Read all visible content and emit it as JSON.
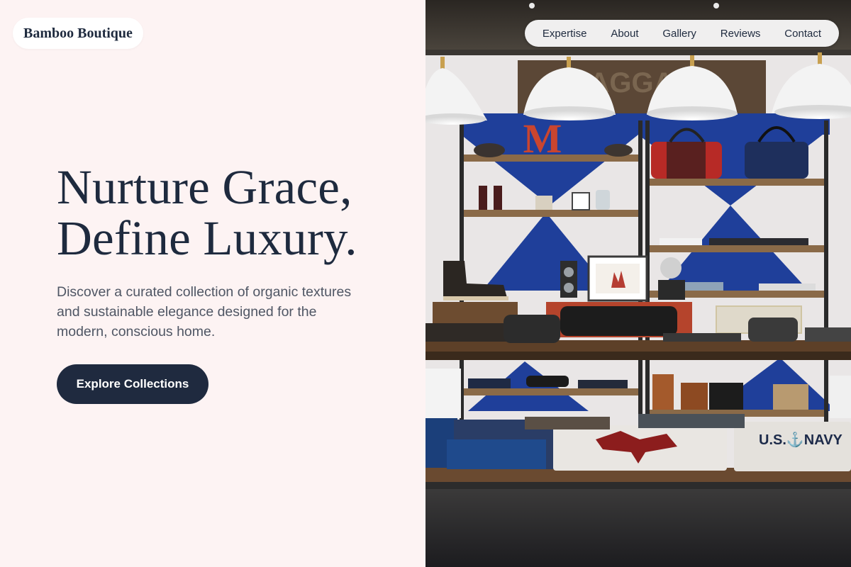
{
  "brand": {
    "name": "Bamboo Boutique"
  },
  "nav": {
    "items": [
      "Expertise",
      "About",
      "Gallery",
      "Reviews",
      "Contact"
    ]
  },
  "hero": {
    "title_line1": "Nurture Grace,",
    "title_line2": "Define Luxury.",
    "subtitle": "Discover a curated collection of organic textures and sustainable elegance designed for the modern, conscious home.",
    "cta_label": "Explore Collections"
  },
  "photo": {
    "wall_sign_text": "BAGGAGE",
    "letter_sign": "M",
    "shirt_print": "U.S.⚓NAVY",
    "icons": [
      "pendant-lamp-icon",
      "camera-icon",
      "boot-icon",
      "bag-icon"
    ]
  },
  "colors": {
    "background": "#fdf3f3",
    "text": "#1e2a3e",
    "button": "#1f2a3f",
    "nav_pill": "#f0efef",
    "shop_blue": "#1f3f9a"
  }
}
